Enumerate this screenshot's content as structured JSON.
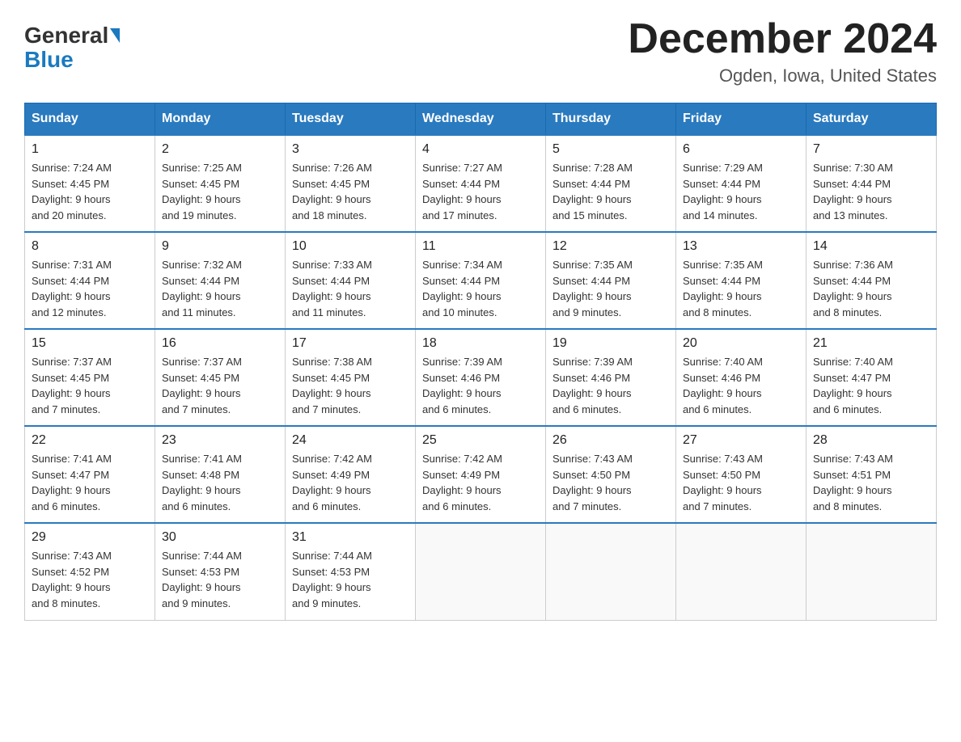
{
  "logo": {
    "general": "General",
    "blue": "Blue"
  },
  "header": {
    "month_title": "December 2024",
    "subtitle": "Ogden, Iowa, United States"
  },
  "weekdays": [
    "Sunday",
    "Monday",
    "Tuesday",
    "Wednesday",
    "Thursday",
    "Friday",
    "Saturday"
  ],
  "weeks": [
    [
      {
        "day": "1",
        "sunrise": "7:24 AM",
        "sunset": "4:45 PM",
        "daylight": "9 hours and 20 minutes."
      },
      {
        "day": "2",
        "sunrise": "7:25 AM",
        "sunset": "4:45 PM",
        "daylight": "9 hours and 19 minutes."
      },
      {
        "day": "3",
        "sunrise": "7:26 AM",
        "sunset": "4:45 PM",
        "daylight": "9 hours and 18 minutes."
      },
      {
        "day": "4",
        "sunrise": "7:27 AM",
        "sunset": "4:44 PM",
        "daylight": "9 hours and 17 minutes."
      },
      {
        "day": "5",
        "sunrise": "7:28 AM",
        "sunset": "4:44 PM",
        "daylight": "9 hours and 15 minutes."
      },
      {
        "day": "6",
        "sunrise": "7:29 AM",
        "sunset": "4:44 PM",
        "daylight": "9 hours and 14 minutes."
      },
      {
        "day": "7",
        "sunrise": "7:30 AM",
        "sunset": "4:44 PM",
        "daylight": "9 hours and 13 minutes."
      }
    ],
    [
      {
        "day": "8",
        "sunrise": "7:31 AM",
        "sunset": "4:44 PM",
        "daylight": "9 hours and 12 minutes."
      },
      {
        "day": "9",
        "sunrise": "7:32 AM",
        "sunset": "4:44 PM",
        "daylight": "9 hours and 11 minutes."
      },
      {
        "day": "10",
        "sunrise": "7:33 AM",
        "sunset": "4:44 PM",
        "daylight": "9 hours and 11 minutes."
      },
      {
        "day": "11",
        "sunrise": "7:34 AM",
        "sunset": "4:44 PM",
        "daylight": "9 hours and 10 minutes."
      },
      {
        "day": "12",
        "sunrise": "7:35 AM",
        "sunset": "4:44 PM",
        "daylight": "9 hours and 9 minutes."
      },
      {
        "day": "13",
        "sunrise": "7:35 AM",
        "sunset": "4:44 PM",
        "daylight": "9 hours and 8 minutes."
      },
      {
        "day": "14",
        "sunrise": "7:36 AM",
        "sunset": "4:44 PM",
        "daylight": "9 hours and 8 minutes."
      }
    ],
    [
      {
        "day": "15",
        "sunrise": "7:37 AM",
        "sunset": "4:45 PM",
        "daylight": "9 hours and 7 minutes."
      },
      {
        "day": "16",
        "sunrise": "7:37 AM",
        "sunset": "4:45 PM",
        "daylight": "9 hours and 7 minutes."
      },
      {
        "day": "17",
        "sunrise": "7:38 AM",
        "sunset": "4:45 PM",
        "daylight": "9 hours and 7 minutes."
      },
      {
        "day": "18",
        "sunrise": "7:39 AM",
        "sunset": "4:46 PM",
        "daylight": "9 hours and 6 minutes."
      },
      {
        "day": "19",
        "sunrise": "7:39 AM",
        "sunset": "4:46 PM",
        "daylight": "9 hours and 6 minutes."
      },
      {
        "day": "20",
        "sunrise": "7:40 AM",
        "sunset": "4:46 PM",
        "daylight": "9 hours and 6 minutes."
      },
      {
        "day": "21",
        "sunrise": "7:40 AM",
        "sunset": "4:47 PM",
        "daylight": "9 hours and 6 minutes."
      }
    ],
    [
      {
        "day": "22",
        "sunrise": "7:41 AM",
        "sunset": "4:47 PM",
        "daylight": "9 hours and 6 minutes."
      },
      {
        "day": "23",
        "sunrise": "7:41 AM",
        "sunset": "4:48 PM",
        "daylight": "9 hours and 6 minutes."
      },
      {
        "day": "24",
        "sunrise": "7:42 AM",
        "sunset": "4:49 PM",
        "daylight": "9 hours and 6 minutes."
      },
      {
        "day": "25",
        "sunrise": "7:42 AM",
        "sunset": "4:49 PM",
        "daylight": "9 hours and 6 minutes."
      },
      {
        "day": "26",
        "sunrise": "7:43 AM",
        "sunset": "4:50 PM",
        "daylight": "9 hours and 7 minutes."
      },
      {
        "day": "27",
        "sunrise": "7:43 AM",
        "sunset": "4:50 PM",
        "daylight": "9 hours and 7 minutes."
      },
      {
        "day": "28",
        "sunrise": "7:43 AM",
        "sunset": "4:51 PM",
        "daylight": "9 hours and 8 minutes."
      }
    ],
    [
      {
        "day": "29",
        "sunrise": "7:43 AM",
        "sunset": "4:52 PM",
        "daylight": "9 hours and 8 minutes."
      },
      {
        "day": "30",
        "sunrise": "7:44 AM",
        "sunset": "4:53 PM",
        "daylight": "9 hours and 9 minutes."
      },
      {
        "day": "31",
        "sunrise": "7:44 AM",
        "sunset": "4:53 PM",
        "daylight": "9 hours and 9 minutes."
      },
      null,
      null,
      null,
      null
    ]
  ]
}
